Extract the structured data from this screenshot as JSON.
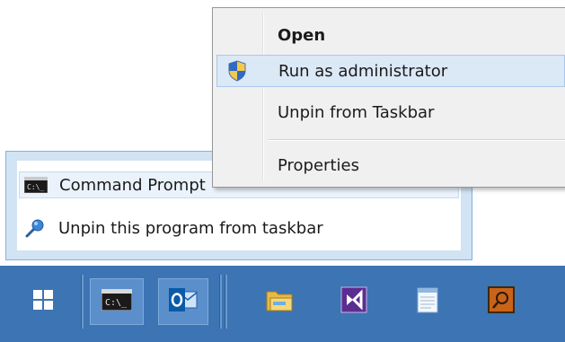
{
  "context_menu": {
    "items": [
      {
        "label": "Open",
        "bold": true
      },
      {
        "label": "Run as administrator",
        "icon": "uac-shield-icon",
        "highlighted": true
      },
      {
        "label": "Unpin from Taskbar"
      },
      {
        "label": "Properties"
      }
    ]
  },
  "jump_list": {
    "items": [
      {
        "label": "Command Prompt",
        "icon": "command-prompt-icon",
        "highlighted": true
      },
      {
        "label": "Unpin this program from taskbar",
        "icon": "unpin-icon"
      }
    ]
  },
  "taskbar": {
    "buttons": [
      {
        "icon": "windows-start-icon"
      },
      {
        "icon": "command-prompt-icon",
        "active": true
      },
      {
        "icon": "outlook-icon",
        "active": true
      },
      {
        "icon": "file-explorer-icon"
      },
      {
        "icon": "visual-studio-icon"
      },
      {
        "icon": "notepad-icon"
      },
      {
        "icon": "app-orange-icon"
      }
    ]
  },
  "colors": {
    "taskbar": "#3d74b3",
    "menu_background": "#f0f0f0",
    "menu_highlight": "#dbe8f6",
    "jumplist_frame": "#d2e3f3"
  }
}
